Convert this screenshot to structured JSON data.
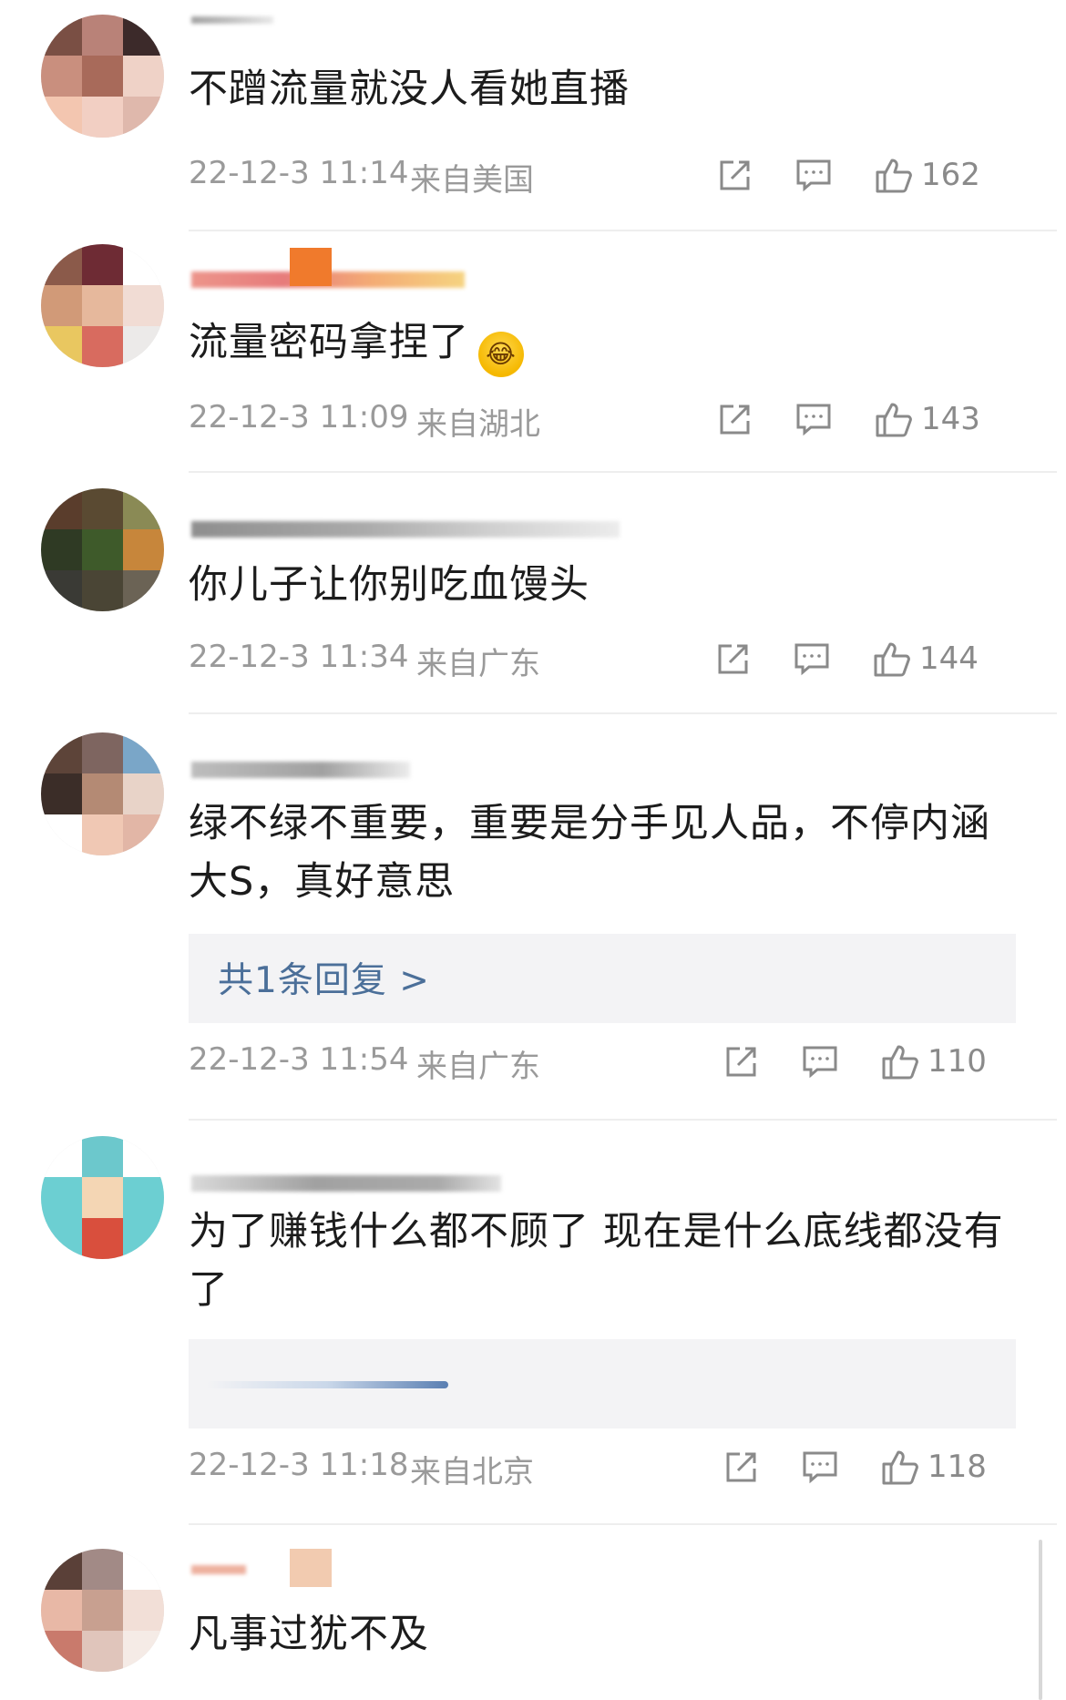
{
  "comments": [
    {
      "text": "不蹭流量就没人看她直播",
      "time": "22-12-3 11:14",
      "location": "来自美国",
      "likes": "162",
      "reply_count_label": "",
      "emoji": ""
    },
    {
      "text": "流量密码拿捏了",
      "time": "22-12-3 11:09",
      "location": "来自湖北",
      "likes": "143",
      "emoji": "😂"
    },
    {
      "text": "你儿子让你别吃血馒头",
      "time": "22-12-3 11:34",
      "location": "来自广东",
      "likes": "144"
    },
    {
      "text": "绿不绿不重要，重要是分手见人品，不停内涵大S，真好意思",
      "time": "22-12-3 11:54",
      "location": "来自广东",
      "likes": "110",
      "reply_link": "共1条回复 >"
    },
    {
      "text": "为了赚钱什么都不顾了  现在是什么底线都没有了",
      "time": "22-12-3 11:18",
      "location": "来自北京",
      "likes": "118"
    },
    {
      "text": "凡事过犹不及"
    }
  ],
  "icons": {
    "share": "share-icon",
    "comment": "comment-icon",
    "like": "thumbs-up-icon"
  },
  "colors": {
    "link": "#4b6f99",
    "meta": "#9a9a9a",
    "divider": "#eeeeee",
    "reply_bg": "#f3f3f5"
  }
}
